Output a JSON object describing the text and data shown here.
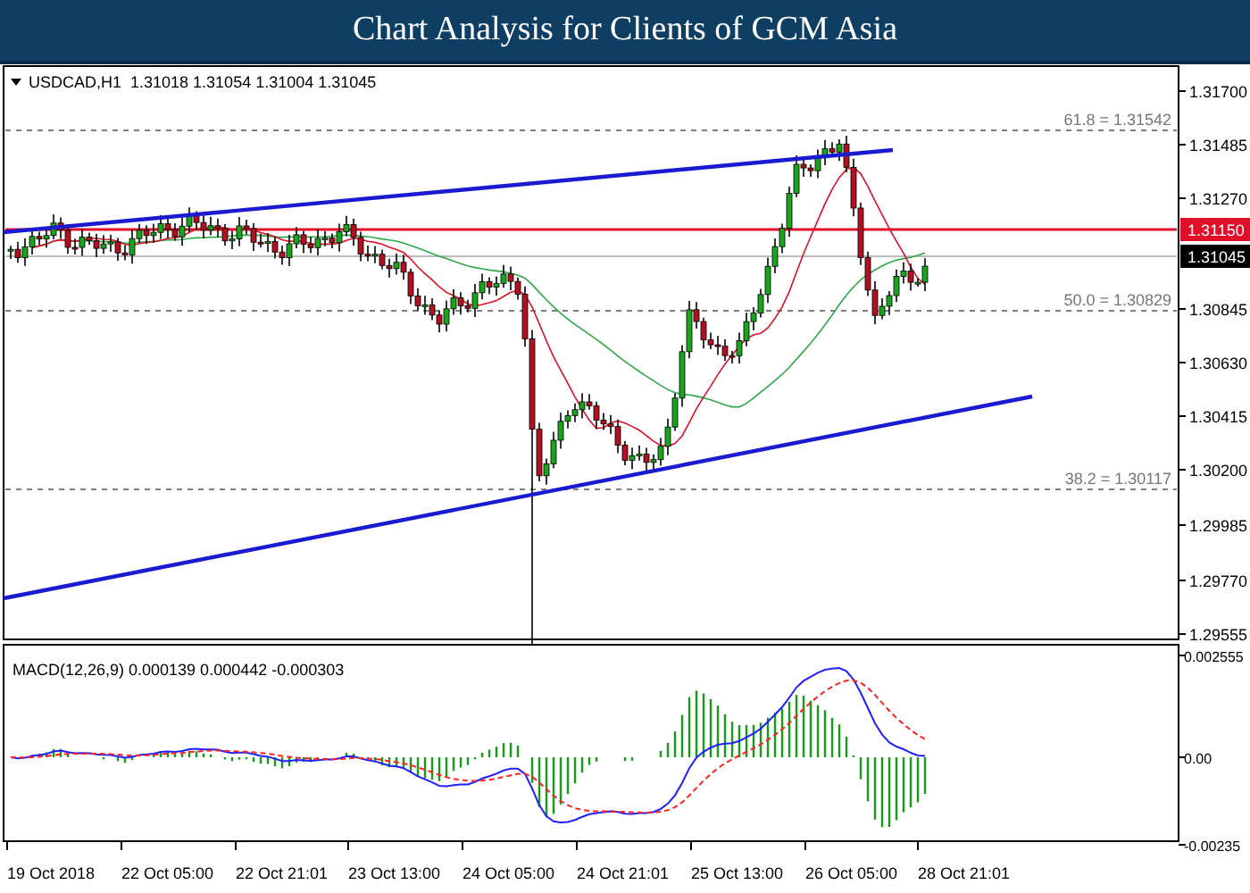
{
  "header": {
    "title": "Chart Analysis for Clients of GCM Asia"
  },
  "price_chart": {
    "symbol_line": "USDCAD,H1  1.31018 1.31054 1.31004 1.31045",
    "fib_levels": [
      {
        "label": "61.8 = 1.31542"
      },
      {
        "label": "50.0 = 1.30829"
      },
      {
        "label": "38.2 = 1.30117"
      }
    ],
    "price_axis": [
      "1.31700",
      "1.31485",
      "1.31270",
      "1.30845",
      "1.30630",
      "1.30415",
      "1.30200",
      "1.29985",
      "1.29770",
      "1.29555"
    ],
    "resistance_price": "1.31150",
    "current_price": "1.31045"
  },
  "macd": {
    "label": "MACD(12,26,9) 0.000139 0.000442 -0.000303",
    "axis": [
      "0.002555",
      "0.00",
      "-0.00235"
    ]
  },
  "time_axis": [
    "19 Oct 2018",
    "22 Oct 05:00",
    "22 Oct 21:01",
    "23 Oct 13:00",
    "24 Oct 05:00",
    "24 Oct 21:01",
    "25 Oct 13:00",
    "26 Oct 05:00",
    "28 Oct 21:01"
  ]
}
